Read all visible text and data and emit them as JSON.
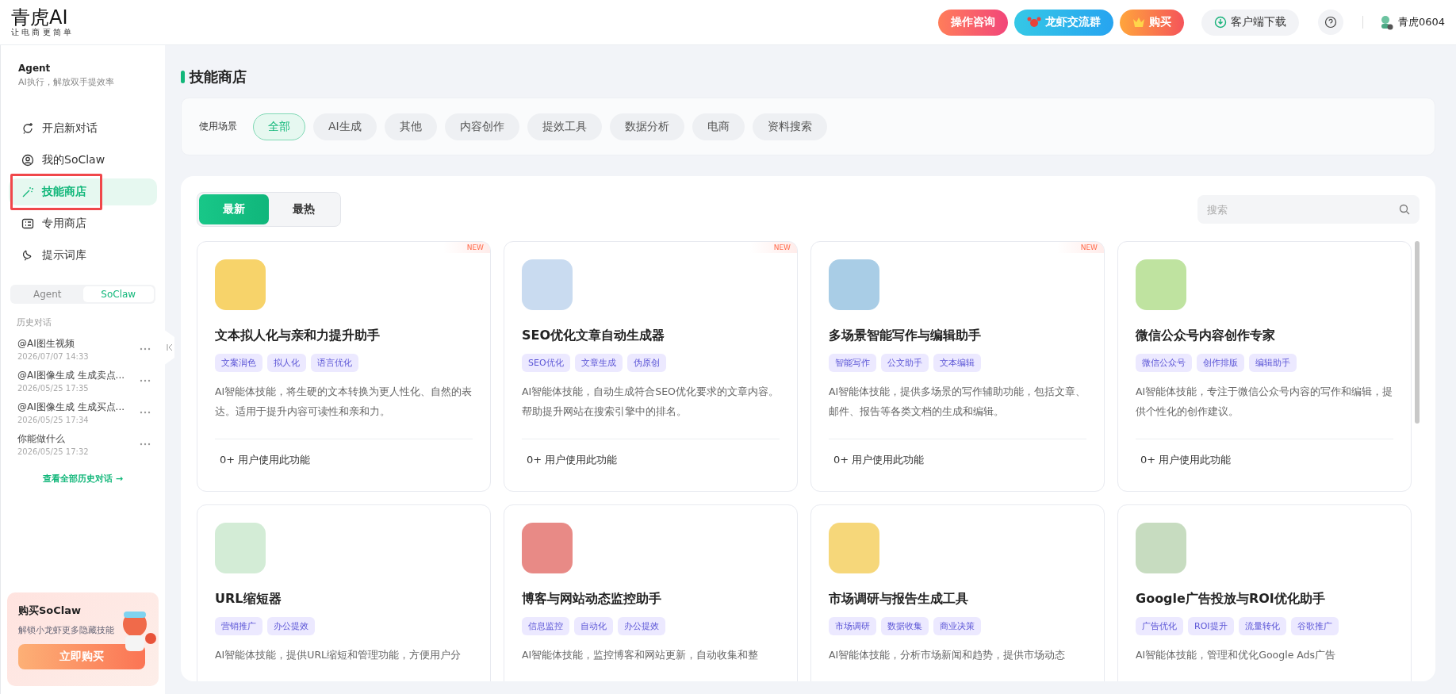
{
  "header": {
    "logo": "青虎AI",
    "slogan": "让 电 商 更 简 单",
    "buttons": [
      {
        "kind": "consult",
        "label": "操作咨询"
      },
      {
        "kind": "group",
        "label": "龙虾交流群"
      },
      {
        "kind": "buy",
        "label": "购买"
      },
      {
        "kind": "download",
        "label": "客户端下载"
      }
    ],
    "user": "青虎0604"
  },
  "sidebar": {
    "title": "Agent",
    "subtitle": "AI执行，解放双手提效率",
    "nav": [
      {
        "kind": "chat",
        "label": "开启新对话",
        "selected": false,
        "outlined": false
      },
      {
        "kind": "user",
        "label": "我的SoClaw",
        "selected": false,
        "outlined": false
      },
      {
        "kind": "wand",
        "label": "技能商店",
        "selected": true,
        "outlined": true
      },
      {
        "kind": "card",
        "label": "专用商店",
        "selected": false,
        "outlined": false
      },
      {
        "kind": "bulb",
        "label": "提示词库",
        "selected": false,
        "outlined": false
      }
    ],
    "modes": [
      {
        "label": "Agent",
        "selected": false
      },
      {
        "label": "SoClaw",
        "selected": true
      }
    ],
    "history_title": "历史对话",
    "history": [
      {
        "title": "@AI图生视频",
        "time": "2026/07/07 14:33"
      },
      {
        "title": "@AI图像生成 生成卖点...",
        "time": "2026/05/25 17:35"
      },
      {
        "title": "@AI图像生成 生成买点...",
        "time": "2026/05/25 17:34"
      },
      {
        "title": "你能做什么",
        "time": "2026/05/25 17:32"
      }
    ],
    "view_all": "查看全部历史对话 →",
    "promo": {
      "title": "购买SoClaw",
      "text": "解锁小龙虾更多隐藏技能",
      "button": "立即购买"
    }
  },
  "page_title": "技能商店",
  "filter": {
    "label": "使用场景",
    "chips": [
      {
        "label": "全部",
        "selected": true
      },
      {
        "label": "AI生成",
        "selected": false
      },
      {
        "label": "其他",
        "selected": false
      },
      {
        "label": "内容创作",
        "selected": false
      },
      {
        "label": "提效工具",
        "selected": false
      },
      {
        "label": "数据分析",
        "selected": false
      },
      {
        "label": "电商",
        "selected": false
      },
      {
        "label": "资料搜索",
        "selected": false
      }
    ]
  },
  "sort_tabs": [
    {
      "label": "最新",
      "selected": true
    },
    {
      "label": "最热",
      "selected": false
    }
  ],
  "search": {
    "placeholder": "搜索"
  },
  "cards": [
    {
      "name": "文本拟人化与亲和力提升助手",
      "badge": "NEW",
      "color": "#f7d36a",
      "tags": [
        "文案润色",
        "拟人化",
        "语言优化"
      ],
      "description": "AI智能体技能，将生硬的文本转换为更人性化、自然的表达。适用于提升内容可读性和亲和力。",
      "footer": "0+ 用户使用此功能"
    },
    {
      "name": "SEO优化文章自动生成器",
      "badge": "NEW",
      "color": "#c9dbf0",
      "tags": [
        "SEO优化",
        "文章生成",
        "伪原创"
      ],
      "description": "AI智能体技能，自动生成符合SEO优化要求的文章内容。帮助提升网站在搜索引擎中的排名。",
      "footer": "0+ 用户使用此功能"
    },
    {
      "name": "多场景智能写作与编辑助手",
      "badge": "NEW",
      "color": "#a9cde6",
      "tags": [
        "智能写作",
        "公文助手",
        "文本编辑"
      ],
      "description": "AI智能体技能，提供多场景的写作辅助功能，包括文章、邮件、报告等各类文档的生成和编辑。",
      "footer": "0+ 用户使用此功能"
    },
    {
      "name": "微信公众号内容创作专家",
      "color": "#bfe3a0",
      "tags": [
        "微信公众号",
        "创作排版",
        "编辑助手"
      ],
      "description": "AI智能体技能，专注于微信公众号内容的写作和编辑，提供个性化的创作建议。",
      "footer": "0+ 用户使用此功能"
    },
    {
      "name": "URL缩短器",
      "color": "#d3ecd6",
      "tags": [
        "营销推广",
        "办公提效"
      ],
      "description": "AI智能体技能，提供URL缩短和管理功能，方便用户分"
    },
    {
      "name": "博客与网站动态监控助手",
      "color": "#e88a86",
      "tags": [
        "信息监控",
        "自动化",
        "办公提效"
      ],
      "description": "AI智能体技能，监控博客和网站更新，自动收集和整"
    },
    {
      "name": "市场调研与报告生成工具",
      "color": "#f6d77a",
      "tags": [
        "市场调研",
        "数据收集",
        "商业决策"
      ],
      "description": "AI智能体技能，分析市场新闻和趋势，提供市场动态"
    },
    {
      "name": "Google广告投放与ROI优化助手",
      "color": "#c7dcc0",
      "tags": [
        "广告优化",
        "ROI提升",
        "流量转化",
        "谷歌推广"
      ],
      "description": "AI智能体技能，管理和优化Google Ads广告"
    }
  ]
}
